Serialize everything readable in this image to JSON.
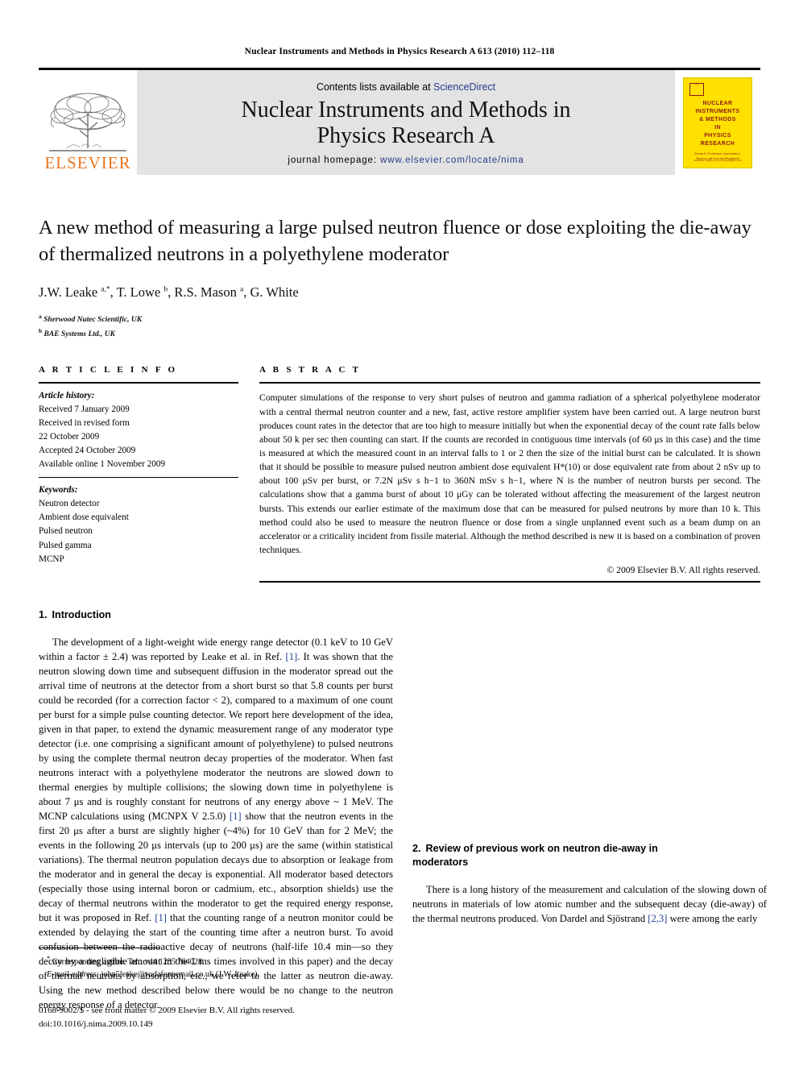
{
  "running_head": "Nuclear Instruments and Methods in Physics Research A 613 (2010) 112–118",
  "masthead": {
    "publisher_name": "ELSEVIER",
    "contents_prefix": "Contents lists available at ",
    "contents_link": "ScienceDirect",
    "journal_title_line1": "Nuclear Instruments and Methods in",
    "journal_title_line2": "Physics Research A",
    "homepage_prefix": "journal homepage: ",
    "homepage_url": "www.elsevier.com/locate/nima",
    "cover": {
      "title_line1": "NUCLEAR",
      "title_line2": "INSTRUMENTS",
      "title_line3": "& METHODS",
      "title_line4": "IN",
      "title_line5": "PHYSICS",
      "title_line6": "RESEARCH",
      "subtitle": "Section A: Accelerators, Spectrometers, Detectors and Associated Equipment",
      "footer": "Available online at www.sciencedirect.com"
    },
    "link_color": "#2A3A8C",
    "elsevier_orange": "#E87722",
    "cover_yellow": "#FFE000",
    "cover_text_color": "#8B1A1A"
  },
  "article": {
    "title": "A new method of measuring a large pulsed neutron fluence or dose exploiting the die-away of thermalized neutrons in a polyethylene moderator",
    "authors": "J.W. Leake a,*, T. Lowe b, R.S. Mason a, G. White",
    "affiliation_a": "Sherwood Nutec Scientific, UK",
    "affiliation_b": "BAE Systems Ltd., UK"
  },
  "article_info": {
    "heading": "A R T I C L E   I N F O",
    "history_label": "Article history:",
    "history": [
      "Received 7 January 2009",
      "Received in revised form",
      "22 October 2009",
      "Accepted 24 October 2009",
      "Available online 1 November 2009"
    ],
    "keywords_label": "Keywords:",
    "keywords": [
      "Neutron detector",
      "Ambient dose equivalent",
      "Pulsed neutron",
      "Pulsed gamma",
      "MCNP"
    ]
  },
  "abstract": {
    "heading": "A B S T R A C T",
    "text": "Computer simulations of the response to very short pulses of neutron and gamma radiation of a spherical polyethylene moderator with a central thermal neutron counter and a new, fast, active restore amplifier system have been carried out. A large neutron burst produces count rates in the detector that are too high to measure initially but when the exponential decay of the count rate falls below about 50 k per sec then counting can start. If the counts are recorded in contiguous time intervals (of 60 μs in this case) and the time is measured at which the measured count in an interval falls to 1 or 2 then the size of the initial burst can be calculated. It is shown that it should be possible to measure pulsed neutron ambient dose equivalent H*(10) or dose equivalent rate from about 2 nSv up to about 100 μSv per burst, or 7.2N μSv s h−1 to 360N mSv s h−1, where N is the number of neutron bursts per second. The calculations show that a gamma burst of about 10 μGy can be tolerated without affecting the measurement of the largest neutron bursts. This extends our earlier estimate of the maximum dose that can be measured for pulsed neutrons by more than 10 k. This method could also be used to measure the neutron fluence or dose from a single unplanned event such as a beam dump on an accelerator or a criticality incident from fissile material. Although the method described is new it is based on a combination of proven techniques.",
    "copyright": "© 2009 Elsevier B.V. All rights reserved."
  },
  "sections": {
    "intro": {
      "number": "1.",
      "title": "Introduction",
      "para1_part1": "The development of a light-weight wide energy range detector (0.1 keV to 10 GeV within a factor ± 2.4) was reported by Leake et al. in Ref. ",
      "para1_ref1": "[1]",
      "para1_part2": ". It was shown that the neutron slowing down time and subsequent diffusion in the moderator spread out the arrival time of neutrons at the detector from a short burst so that 5.8 counts per burst could be recorded (for a correction factor < 2), compared to a maximum of one count per burst for a simple pulse counting detector. We report here development of the idea, given in that paper, to extend the dynamic measurement range of any moderator type detector (i.e. one comprising a significant amount of polyethylene) to pulsed neutrons by using the complete thermal neutron decay properties of the moderator. When fast neutrons interact with a polyethylene moderator the neutrons are slowed down to thermal energies by multiple collisions; the slowing down time in polyethylene is about 7 μs and is roughly constant for neutrons of any energy above ~ 1 MeV. The MCNP calculations using (MCNPX V 2.5.0) ",
      "para1_ref2": "[1]",
      "para1_part3": " show that the neutron events in the first 20 μs after a burst are slightly higher (~4%) for 10 GeV than for 2 MeV; the events in the following 20 μs intervals (up to 200 μs) are the same (within statistical variations). The thermal neutron population decays due to absorption or leakage from the moderator and in general the decay is exponential. All moderator based detectors (especially those using internal boron or cadmium, etc., absorption shields) use the decay of thermal neutrons within the moderator to get the required energy response, but it was proposed in Ref. ",
      "para1_ref3": "[1]",
      "para1_part4": " that the counting range of a neutron monitor could be extended by delaying the start of the counting time after a neutron burst. To avoid confusion between the radioactive decay of neutrons (half-life 10.4 min—so they decay by a negligible amount in the 1 ms times involved in this paper) and the decay of thermal neutrons by absorption, etc., we refer to the latter as neutron die-away. Using the new method described below there would be no change to the neutron energy response of a detector."
    },
    "review": {
      "number": "2.",
      "title_line1": "Review of previous work on neutron die-away in",
      "title_line2": "moderators",
      "para1_part1": "There is a long history of the measurement and calculation of the slowing down of neutrons in materials of low atomic number and the subsequent decay (die-away) of the thermal neutrons produced. Von Dardel and Sjöstrand ",
      "para1_ref1": "[2,3]",
      "para1_part2": " were among the early"
    }
  },
  "footnotes": {
    "corresponding_marker": "*",
    "corresponding": " Corresponding author. Tel.: +44 1235 764028.",
    "email_label": "E-mail address:",
    "email_value": " john5leake@vodafoneemail.co.uk (J.W. Leake).",
    "issn_line": "0168-9002/$ - see front matter © 2009 Elsevier B.V. All rights reserved.",
    "doi_line": "doi:10.1016/j.nima.2009.10.149"
  }
}
